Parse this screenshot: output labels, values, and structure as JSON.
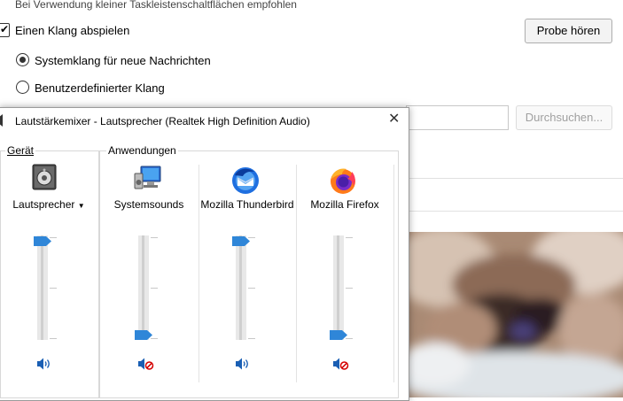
{
  "settings": {
    "hint_text": "Bei Verwendung kleiner Taskleistenschaltflächen empfohlen",
    "play_sound_label": "Einen Klang abspielen",
    "play_sound_checked": true,
    "preview_button": "Probe hören",
    "radio_system_label": "Systemklang für neue Nachrichten",
    "radio_custom_label": "Benutzerdefinierter Klang",
    "selected_radio": "system",
    "custom_sound_value": "",
    "browse_button": "Durchsuchen..."
  },
  "mixer": {
    "title": "Lautstärkemixer - Lautsprecher (Realtek High Definition Audio)",
    "device_group_label": "Gerät",
    "apps_group_label": "Anwendungen",
    "channels": [
      {
        "id": "device",
        "name": "Lautsprecher",
        "icon": "speaker-device-icon",
        "has_dropdown": true,
        "level": 1.0,
        "muted": false
      },
      {
        "id": "system",
        "name": "Systemsounds",
        "icon": "system-sounds-icon",
        "has_dropdown": false,
        "level": 0.0,
        "muted": true
      },
      {
        "id": "thunderbird",
        "name": "Mozilla Thunderbird",
        "icon": "thunderbird-icon",
        "has_dropdown": false,
        "level": 1.0,
        "muted": false
      },
      {
        "id": "firefox",
        "name": "Mozilla Firefox",
        "icon": "firefox-icon",
        "has_dropdown": false,
        "level": 0.0,
        "muted": true
      }
    ]
  },
  "colors": {
    "accent": "#1a73e8",
    "thumb": "#2f86d8",
    "mute_red": "#d40000"
  }
}
